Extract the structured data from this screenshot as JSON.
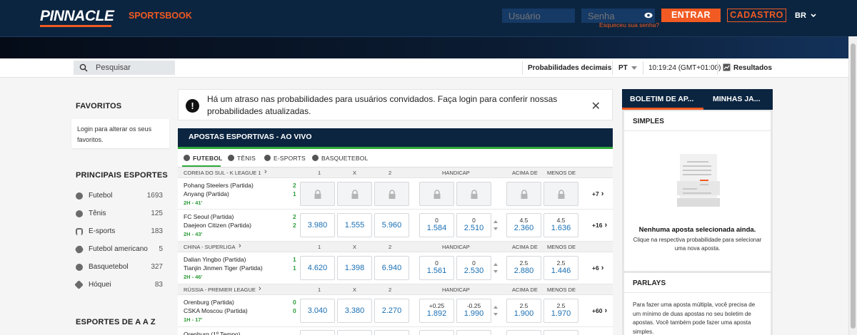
{
  "header": {
    "logo": "PINNACLE",
    "sportsbook_link": "SPORTSBOOK",
    "username_placeholder": "Usuário",
    "password_placeholder": "Senha",
    "forgot_password": "Esqueceu sua senha?",
    "login_button": "ENTRAR",
    "register_button": "CADASTRO",
    "language": "BR"
  },
  "toolbar": {
    "search_placeholder": "Pesquisar",
    "odds_format": "Probabilidades decimais",
    "language": "PT",
    "clock": "10:19:24 (GMT+01:00)",
    "results": "Resultados"
  },
  "sidebar": {
    "favorites_title": "FAVORITOS",
    "favorites_note": "Login para alterar os seus favoritos.",
    "main_sports_title": "PRINCIPAIS ESPORTES",
    "sports": [
      {
        "name": "Futebol",
        "count": "1693"
      },
      {
        "name": "Tênis",
        "count": "125"
      },
      {
        "name": "E-sports",
        "count": "183"
      },
      {
        "name": "Futebol americano",
        "count": "5"
      },
      {
        "name": "Basquetebol",
        "count": "327"
      },
      {
        "name": "Hóquei",
        "count": "83"
      }
    ],
    "az_title": "ESPORTES DE A A Z"
  },
  "notice": {
    "text": "Há um atraso nas probabilidades para usuários convidados. Faça login para conferir nossas probabilidades atualizadas."
  },
  "live": {
    "title": "APOSTAS ESPORTIVAS - AO VIVO",
    "tabs": [
      "FUTEBOL",
      "TÊNIS",
      "E-SPORTS",
      "BASQUETEBOL"
    ],
    "columns": {
      "one": "1",
      "x": "X",
      "two": "2",
      "handicap": "HANDICAP",
      "over": "ACIMA DE",
      "under": "MENOS DE"
    },
    "leagues": [
      {
        "name": "COREIA DO SUL - K LEAGUE 1"
      },
      {
        "name": "CHINA - SUPERLIGA"
      },
      {
        "name": "RÚSSIA - PREMIER LEAGUE"
      }
    ],
    "events": [
      {
        "home": "Pohang Steelers (Partida)",
        "away": "Anyang (Partida)",
        "home_score": "2",
        "away_score": "1",
        "time": "2H - 41'",
        "more": "+7"
      },
      {
        "home": "FC Seoul (Partida)",
        "away": "Daejeon Citizen (Partida)",
        "home_score": "2",
        "away_score": "2",
        "time": "2H - 43'",
        "o1": "3.980",
        "ox": "1.555",
        "o2": "5.960",
        "h1_line": "0",
        "h1": "1.584",
        "h2_line": "0",
        "h2": "2.510",
        "ov_line": "4.5",
        "ov": "2.360",
        "un_line": "4.5",
        "un": "1.636",
        "more": "+16"
      },
      {
        "home": "Dalian Yingbo (Partida)",
        "away": "Tianjin Jinmen Tiger (Partida)",
        "home_score": "1",
        "away_score": "1",
        "time": "2H - 46'",
        "o1": "4.620",
        "ox": "1.398",
        "o2": "6.940",
        "h1_line": "0",
        "h1": "1.561",
        "h2_line": "0",
        "h2": "2.530",
        "ov_line": "2.5",
        "ov": "2.880",
        "un_line": "2.5",
        "un": "1.446",
        "more": "+6"
      },
      {
        "home": "Orenburg (Partida)",
        "away": "CSKA Moscou (Partida)",
        "home_score": "0",
        "away_score": "0",
        "time": "1H - 17'",
        "o1": "3.040",
        "ox": "3.380",
        "o2": "2.270",
        "h1_line": "+0.25",
        "h1": "1.892",
        "h2_line": "-0.25",
        "h2": "1.990",
        "ov_line": "2.5",
        "ov": "1.900",
        "un_line": "2.5",
        "un": "1.970",
        "more": "+60"
      },
      {
        "home": "Orenburg (1º Tempo)"
      }
    ]
  },
  "betslip": {
    "tab_betslip": "BOLETIM DE AP...",
    "tab_mybets": "MINHAS JA...",
    "singles_title": "SIMPLES",
    "empty_title": "Nenhuma aposta selecionada ainda.",
    "empty_desc": "Clique na respectiva probabilidade para selecionar uma nova aposta.",
    "parlays_title": "PARLAYS",
    "parlays_desc": "Para fazer uma aposta múltipla, você precisa de um mínimo de duas apostas no seu boletim de apostas. Você também pode fazer uma aposta simples."
  },
  "colors": {
    "navy": "#0b2540",
    "orange": "#f15a22",
    "live_green": "#2eaa3a",
    "odds_blue": "#1a6fb3"
  }
}
